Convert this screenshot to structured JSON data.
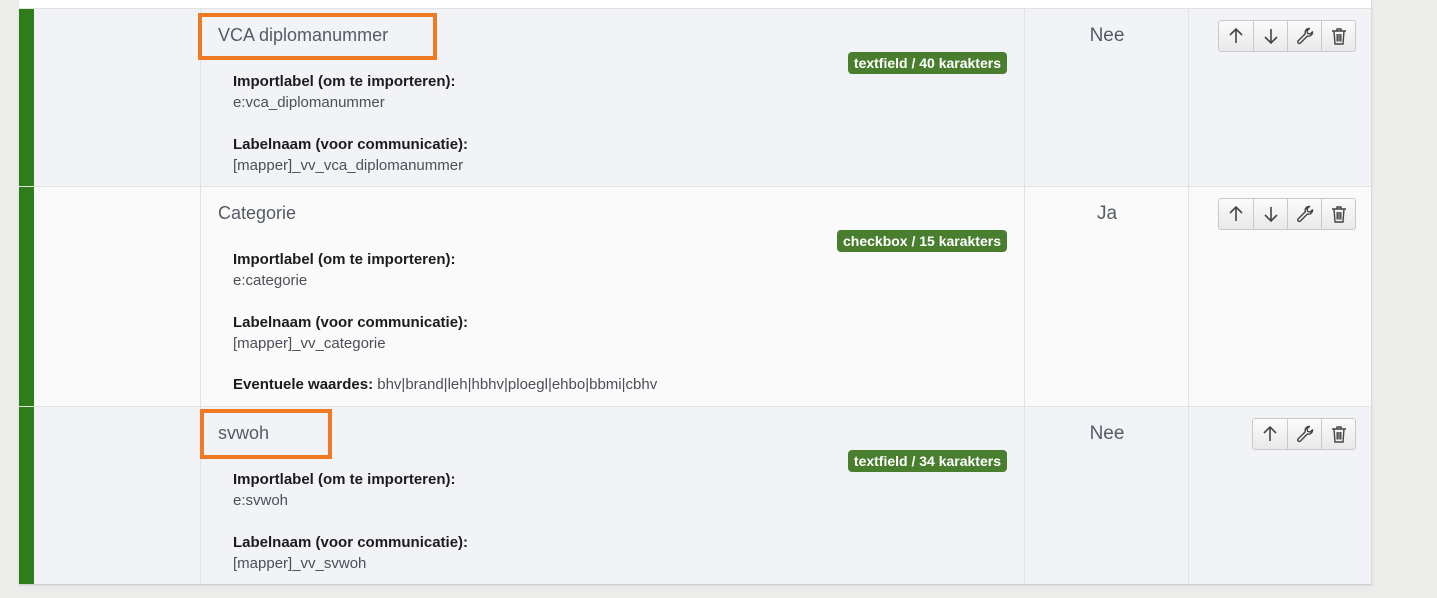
{
  "rows": [
    {
      "title": "VCA diplomanummer",
      "badge": "textfield / 40 karakters",
      "import_label_caption": "Importlabel (om te importeren):",
      "import_label_value": "e:vca_diplomanummer",
      "label_name_caption": "Labelnaam (voor communicatie):",
      "label_name_value": "[mapper]_vv_vca_diplomanummer",
      "required": "Nee"
    },
    {
      "title": "Categorie",
      "badge": "checkbox / 15 karakters",
      "import_label_caption": "Importlabel (om te importeren):",
      "import_label_value": "e:categorie",
      "label_name_caption": "Labelnaam (voor communicatie):",
      "label_name_value": "[mapper]_vv_categorie",
      "values_caption": "Eventuele waardes:",
      "values_value": "bhv|brand|leh|hbhv|ploegl|ehbo|bbmi|cbhv",
      "required": "Ja"
    },
    {
      "title": "svwoh",
      "badge": "textfield / 34 karakters",
      "import_label_caption": "Importlabel (om te importeren):",
      "import_label_value": "e:svwoh",
      "label_name_caption": "Labelnaam (voor communicatie):",
      "label_name_value": "[mapper]_vv_svwoh",
      "required": "Nee"
    }
  ],
  "icons": {
    "up": "arrow-up-icon",
    "down": "arrow-down-icon",
    "edit": "wrench-icon",
    "delete": "trash-icon"
  },
  "colors": {
    "row_bar": "#2e7d1a",
    "badge": "#4a7e2f",
    "highlight": "#ee7a23"
  }
}
